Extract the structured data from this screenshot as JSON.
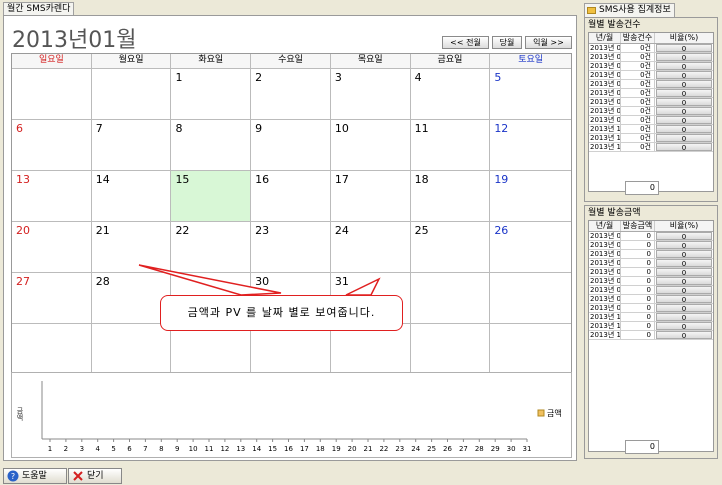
{
  "window_tab": "월간 SMS카렌다",
  "right_tab": "SMS사용 집계정보",
  "title": "2013년01월",
  "nav": {
    "prev": "<< 전월",
    "current": "당월",
    "next": "익월 >>"
  },
  "weekdays": [
    "일요일",
    "월요일",
    "화요일",
    "수요일",
    "목요일",
    "금요일",
    "토요일"
  ],
  "weeks": [
    [
      "",
      "",
      "1",
      "2",
      "3",
      "4",
      "5"
    ],
    [
      "6",
      "7",
      "8",
      "9",
      "10",
      "11",
      "12"
    ],
    [
      "13",
      "14",
      "15",
      "16",
      "17",
      "18",
      "19"
    ],
    [
      "20",
      "21",
      "22",
      "23",
      "24",
      "25",
      "26"
    ],
    [
      "27",
      "28",
      "",
      "30",
      "31",
      "",
      ""
    ],
    [
      "",
      "",
      "",
      "",
      "",
      "",
      ""
    ]
  ],
  "today": "15",
  "chart": {
    "y_label": "금액",
    "legend": "금액",
    "legend_color": "#f0c060",
    "x_ticks": [
      "1",
      "2",
      "3",
      "4",
      "5",
      "6",
      "7",
      "8",
      "9",
      "10",
      "11",
      "12",
      "13",
      "14",
      "15",
      "16",
      "17",
      "18",
      "19",
      "20",
      "21",
      "22",
      "23",
      "24",
      "25",
      "26",
      "27",
      "28",
      "29",
      "30",
      "31"
    ]
  },
  "monthly_count": {
    "title": "월별 발송건수",
    "headers": [
      "년/월",
      "발송건수",
      "비율(%)"
    ],
    "rows": [
      [
        "2013년 01",
        "0건",
        "0"
      ],
      [
        "2013년 02",
        "0건",
        "0"
      ],
      [
        "2013년 03",
        "0건",
        "0"
      ],
      [
        "2013년 04",
        "0건",
        "0"
      ],
      [
        "2013년 05",
        "0건",
        "0"
      ],
      [
        "2013년 06",
        "0건",
        "0"
      ],
      [
        "2013년 07",
        "0건",
        "0"
      ],
      [
        "2013년 08",
        "0건",
        "0"
      ],
      [
        "2013년 09",
        "0건",
        "0"
      ],
      [
        "2013년 10",
        "0건",
        "0"
      ],
      [
        "2013년 11",
        "0건",
        "0"
      ],
      [
        "2013년 12",
        "0건",
        "0"
      ]
    ],
    "total": "0"
  },
  "monthly_amount": {
    "title": "월별 발송금액",
    "headers": [
      "년/월",
      "발송금액",
      "비율(%)"
    ],
    "rows": [
      [
        "2013년 01",
        "0",
        "0"
      ],
      [
        "2013년 02",
        "0",
        "0"
      ],
      [
        "2013년 03",
        "0",
        "0"
      ],
      [
        "2013년 04",
        "0",
        "0"
      ],
      [
        "2013년 05",
        "0",
        "0"
      ],
      [
        "2013년 06",
        "0",
        "0"
      ],
      [
        "2013년 07",
        "0",
        "0"
      ],
      [
        "2013년 08",
        "0",
        "0"
      ],
      [
        "2013년 09",
        "0",
        "0"
      ],
      [
        "2013년 10",
        "0",
        "0"
      ],
      [
        "2013년 11",
        "0",
        "0"
      ],
      [
        "2013년 12",
        "0",
        "0"
      ]
    ],
    "total": "0"
  },
  "bottom": {
    "help": "도움말[F8]",
    "close": "닫기[F12]"
  },
  "callout": "금액과 PV 를 날짜 별로 보여줍니다."
}
